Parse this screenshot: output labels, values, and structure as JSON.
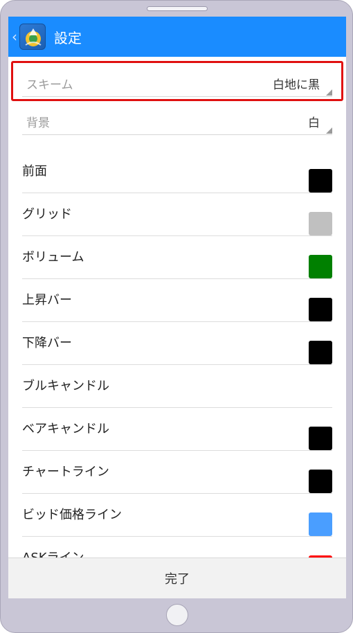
{
  "appbar": {
    "back_icon": "chevron-left-icon",
    "logo_icon": "metatrader-logo-icon",
    "title": "設定"
  },
  "settings": {
    "scheme": {
      "label": "スキーム",
      "value": "白地に黒"
    },
    "background": {
      "label": "背景",
      "value": "白"
    },
    "items": [
      {
        "label": "前面",
        "color": "#000000"
      },
      {
        "label": "グリッド",
        "color": "#c0c0c0"
      },
      {
        "label": "ボリューム",
        "color": "#008000"
      },
      {
        "label": "上昇バー",
        "color": "#000000"
      },
      {
        "label": "下降バー",
        "color": "#000000"
      },
      {
        "label": "ブルキャンドル",
        "color": "#ffffff"
      },
      {
        "label": "ベアキャンドル",
        "color": "#000000"
      },
      {
        "label": "チャートライン",
        "color": "#000000"
      },
      {
        "label": "ビッド価格ライン",
        "color": "#4a9eff"
      },
      {
        "label": "ASKライン",
        "color": "#ff0000"
      }
    ]
  },
  "footer": {
    "done_label": "完了"
  },
  "colors": {
    "appbar": "#1a8cff",
    "highlight_border": "#e01010"
  }
}
